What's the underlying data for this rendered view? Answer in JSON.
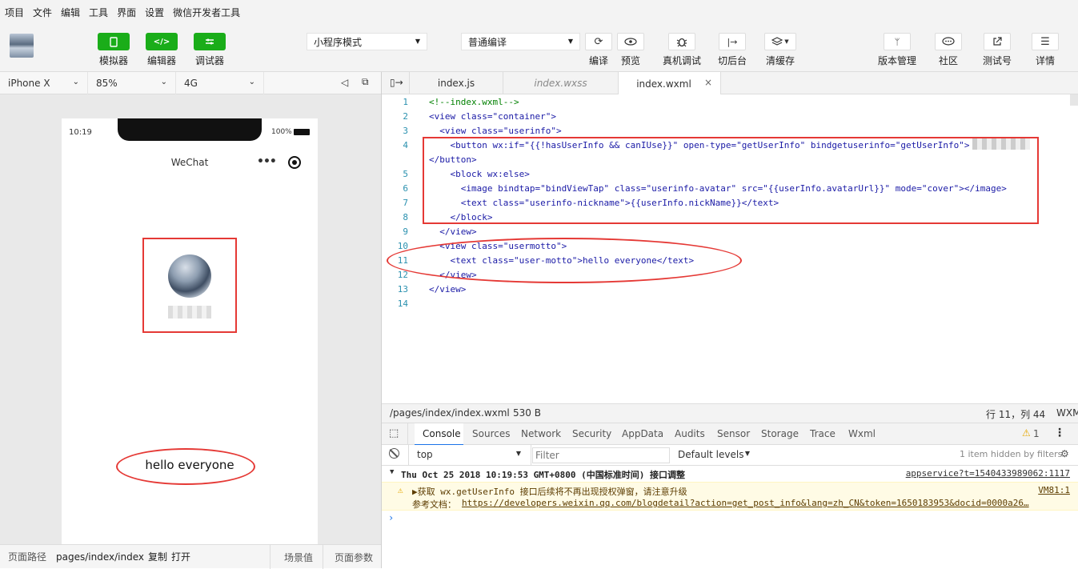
{
  "menu": [
    "项目",
    "文件",
    "编辑",
    "工具",
    "界面",
    "设置",
    "微信开发者工具"
  ],
  "toolbar": {
    "mode_buttons": [
      {
        "label": "模拟器",
        "icon": "phone-icon"
      },
      {
        "label": "编辑器",
        "icon": "code-icon"
      },
      {
        "label": "调试器",
        "icon": "debug-icon"
      }
    ],
    "mode_select": "小程序模式",
    "compile_select": "普通编译",
    "actions": [
      {
        "label": "编译",
        "icon": "refresh-icon"
      },
      {
        "label": "预览",
        "icon": "eye-icon"
      },
      {
        "label": "真机调试",
        "icon": "bug-icon"
      },
      {
        "label": "切后台",
        "icon": "switch-icon"
      },
      {
        "label": "清缓存",
        "icon": "layers-icon"
      }
    ],
    "right_actions": [
      {
        "label": "版本管理",
        "icon": "branch-icon"
      },
      {
        "label": "社区",
        "icon": "chat-icon"
      },
      {
        "label": "测试号",
        "icon": "external-icon"
      },
      {
        "label": "详情",
        "icon": "menu-icon"
      }
    ]
  },
  "device": {
    "model": "iPhone X",
    "zoom": "85%",
    "network": "4G"
  },
  "phone": {
    "time": "10:19",
    "battery": "100%",
    "nav_title": "WeChat",
    "motto": "hello everyone"
  },
  "left_footer": {
    "path_label": "页面路径",
    "path": "pages/index/index",
    "copy": "复制",
    "open": "打开",
    "scene": "场景值",
    "params": "页面参数"
  },
  "editor_tabs": [
    "index.js",
    "index.wxss",
    "index.wxml"
  ],
  "code_lines": [
    {
      "n": "1",
      "t": "<!--index.wxml-->"
    },
    {
      "n": "2",
      "t": "<view class=\"container\">"
    },
    {
      "n": "3",
      "t": "  <view class=\"userinfo\">"
    },
    {
      "n": "4",
      "t": "    <button wx:if=\"{{!hasUserInfo && canIUse}}\" open-type=\"getUserInfo\" bindgetuserinfo=\"getUserInfo\">"
    },
    {
      "n": "",
      "t": "</button>"
    },
    {
      "n": "5",
      "t": "    <block wx:else>"
    },
    {
      "n": "6",
      "t": "      <image bindtap=\"bindViewTap\" class=\"userinfo-avatar\" src=\"{{userInfo.avatarUrl}}\" mode=\"cover\"></image>"
    },
    {
      "n": "7",
      "t": "      <text class=\"userinfo-nickname\">{{userInfo.nickName}}</text>"
    },
    {
      "n": "8",
      "t": "    </block>"
    },
    {
      "n": "9",
      "t": "  </view>"
    },
    {
      "n": "10",
      "t": "  <view class=\"usermotto\">"
    },
    {
      "n": "11",
      "t": "    <text class=\"user-motto\">hello everyone</text>"
    },
    {
      "n": "12",
      "t": "  </view>"
    },
    {
      "n": "13",
      "t": "</view>"
    },
    {
      "n": "14",
      "t": ""
    }
  ],
  "status": {
    "path": "/pages/index/index.wxml",
    "size": "530 B",
    "cursor": "行 11，列 44",
    "lang": "WXM"
  },
  "console_tabs": [
    "Console",
    "Sources",
    "Network",
    "Security",
    "AppData",
    "Audits",
    "Sensor",
    "Storage",
    "Trace",
    "Wxml"
  ],
  "warnings_count": "1",
  "filter": {
    "context": "top",
    "placeholder": "Filter",
    "levels": "Default levels",
    "hidden": "1 item hidden by filters"
  },
  "console": {
    "group_title": "Thu Oct 25 2018 10:19:53 GMT+0800 (中国标准时间) 接口调整",
    "group_src": "appservice?t=1540433989062:1117",
    "warn_line1": "▶获取 wx.getUserInfo 接口后续将不再出现授权弹窗，请注意升级",
    "warn_src": "VM81:1",
    "warn_line2_label": "参考文档：",
    "warn_link": "https://developers.weixin.qq.com/blogdetail?action=get_post_info&lang=zh_CN&token=1650183953&docid=0000a26…"
  }
}
